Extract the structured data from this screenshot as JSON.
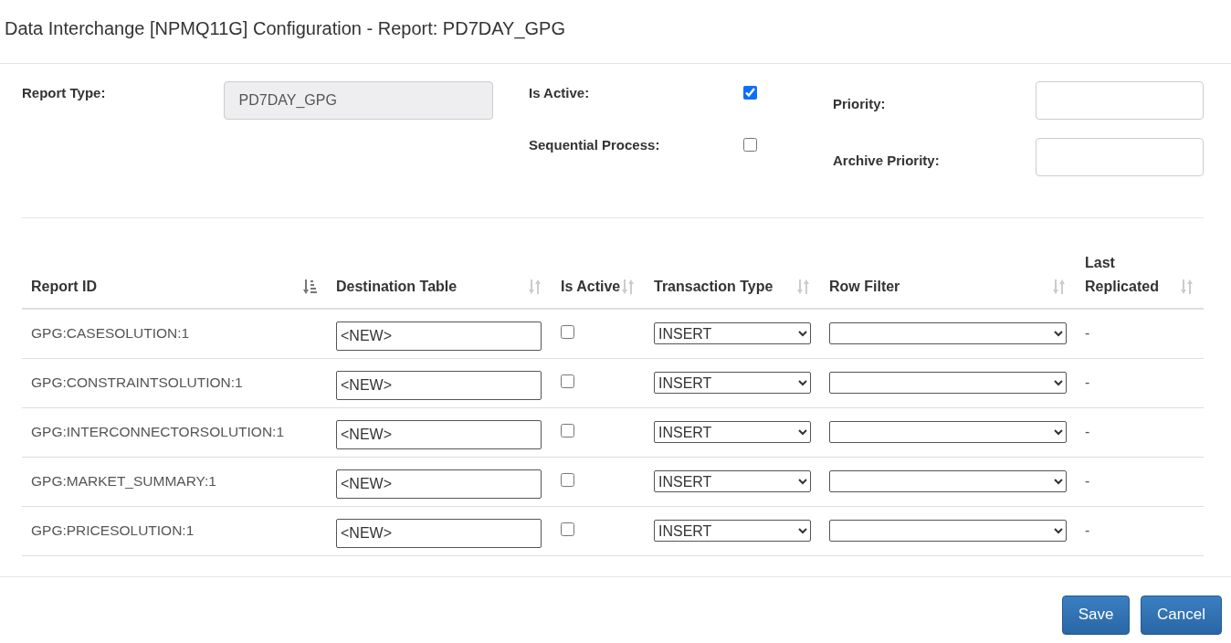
{
  "window": {
    "title": "Data Interchange [NPMQ11G] Configuration - Report: PD7DAY_GPG"
  },
  "form": {
    "report_type": {
      "label": "Report Type:",
      "value": "PD7DAY_GPG",
      "disabled": true
    },
    "is_active": {
      "label": "Is Active:",
      "checked": true
    },
    "sequential_process": {
      "label": "Sequential Process:",
      "checked": false
    },
    "priority": {
      "label": "Priority:"
    },
    "archive_priority": {
      "label": "Archive Priority:"
    }
  },
  "table": {
    "columns": [
      {
        "label": "Report ID",
        "sorted": true
      },
      {
        "label": "Destination Table",
        "sorted": false
      },
      {
        "label": "Is Active",
        "sorted": false
      },
      {
        "label": "Transaction Type",
        "sorted": false
      },
      {
        "label": "Row Filter",
        "sorted": false
      },
      {
        "label": "Last Replicated",
        "sorted": false
      }
    ],
    "rows": [
      {
        "report_id": "GPG:CASESOLUTION:1",
        "destination_table": "<NEW>",
        "is_active": false,
        "transaction_type": "INSERT",
        "last_replicated": "-"
      },
      {
        "report_id": "GPG:CONSTRAINTSOLUTION:1",
        "destination_table": "<NEW>",
        "is_active": false,
        "transaction_type": "INSERT",
        "last_replicated": "-"
      },
      {
        "report_id": "GPG:INTERCONNECTORSOLUTION:1",
        "destination_table": "<NEW>",
        "is_active": false,
        "transaction_type": "INSERT",
        "last_replicated": "-"
      },
      {
        "report_id": "GPG:MARKET_SUMMARY:1",
        "destination_table": "<NEW>",
        "is_active": false,
        "transaction_type": "INSERT",
        "last_replicated": "-"
      },
      {
        "report_id": "GPG:PRICESOLUTION:1",
        "destination_table": "<NEW>",
        "is_active": false,
        "transaction_type": "INSERT",
        "last_replicated": "-"
      }
    ]
  },
  "buttons": [
    "Save",
    "Cancel"
  ]
}
